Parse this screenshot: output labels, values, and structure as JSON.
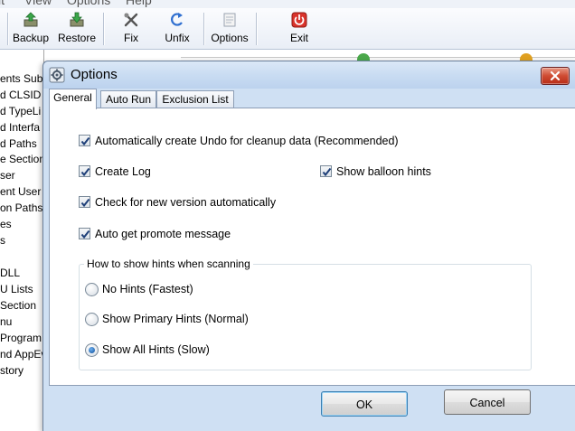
{
  "app": {
    "menu": [
      "it",
      "View",
      "Options",
      "Help"
    ],
    "toolbar": [
      {
        "id": "backup",
        "label": "Backup",
        "icon": "backup-icon"
      },
      {
        "id": "restore",
        "label": "Restore",
        "icon": "restore-icon"
      },
      {
        "id": "fix",
        "label": "Fix",
        "icon": "fix-icon"
      },
      {
        "id": "unfix",
        "label": "Unfix",
        "icon": "unfix-icon"
      },
      {
        "id": "options",
        "label": "Options",
        "icon": "options-icon"
      },
      {
        "id": "exit",
        "label": "Exit",
        "icon": "exit-icon"
      }
    ],
    "tree_items": [
      "ents Sub",
      "d CLSID",
      "d TypeLi",
      "d Interfa",
      "d Paths",
      "e Section",
      "ser",
      "ent User",
      "on Paths",
      "es",
      "s",
      "",
      "DLL",
      "U Lists",
      "Section",
      "nu",
      "Program",
      "nd AppEv",
      "story"
    ]
  },
  "dialog": {
    "title": "Options",
    "tabs": [
      "General",
      "Auto Run",
      "Exclusion List"
    ],
    "active_tab": "General",
    "options": {
      "auto_undo": {
        "label": "Automatically create Undo for cleanup data (Recommended)",
        "checked": true
      },
      "create_log": {
        "label": "Create Log",
        "checked": true
      },
      "balloon_hints": {
        "label": "Show balloon hints",
        "checked": true
      },
      "check_version": {
        "label": "Check for new version automatically",
        "checked": true
      },
      "promote_msg": {
        "label": "Auto get promote message",
        "checked": true
      }
    },
    "hints_group": {
      "title": "How to show hints when scanning",
      "choices": [
        {
          "label": "No Hints (Fastest)",
          "checked": false
        },
        {
          "label": "Show Primary Hints (Normal)",
          "checked": false
        },
        {
          "label": "Show All Hints (Slow)",
          "checked": true
        }
      ]
    },
    "buttons": {
      "ok": "OK",
      "cancel": "Cancel"
    }
  }
}
